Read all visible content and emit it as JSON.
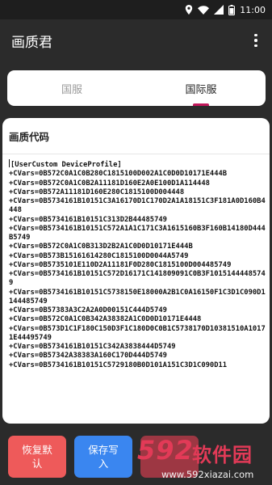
{
  "status_bar": {
    "time": "11:00"
  },
  "app": {
    "title": "画质君"
  },
  "tabs": [
    {
      "label": "国服",
      "active": false
    },
    {
      "label": "国际服",
      "active": true
    }
  ],
  "card": {
    "header": "画质代码",
    "code_lines": [
      "[UserCustom DeviceProfile]",
      "+CVars=0B572C0A1C0B280C1815100D002A1C0D0D10171E444B",
      "+CVars=0B572C0A1C0B2A11181D160E2A0E100D1A114448",
      "+CVars=0B572A11181D160E280C1815100D004448",
      "+CVars=0B5734161B10151C3A16170D1C170D2A1A18151C3F181A0D160B4448",
      "+CVars=0B5734161B10151C313D2B44485749",
      "+CVars=0B5734161B10151C572A1A1C171C3A1615160B3F160B14180D444B5749",
      "+CVars=0B572C0A1C0B313D2B2A1C0D0D10171E444B",
      "+CVars=0B573B15161614280C1815100D0044A5749",
      "+CVars=0B5735101E110D2A11181F0D280C1815100D004485749",
      "+CVars=0B5734161B10151C572D16171C141809091C0B3F10151444485749",
      "+CVars=0B5734161B10151C5738150E18000A2B1C0A16150F1C3D1C090D1144485749",
      "+CVars=0B57383A3C2A2A0D00151C444D5749",
      "+CVars=0B572C0A1C0B342A38382A1C0D0D10171E4448",
      "+CVars=0B573D1C1F180C150D3F1C180D0C0B1C5738170D10381510A10171E44495749",
      "+CVars=0B5734161B10151C342A3838444D5749",
      "+CVars=0B57342A38383A160C170D444D5749",
      "+CVars=0B5734161B10151C5729180B0D101A151C3D1C090D11"
    ]
  },
  "buttons": {
    "restore_label": "恢复默认",
    "save_label": "保存写入",
    "third_label": ""
  },
  "watermark": {
    "brand": "592",
    "cn": "软件园",
    "url": "www.592xiazai.com"
  },
  "colors": {
    "background": "#2b2b2b",
    "tab_indicator": "#c2185b",
    "restore_button": "#ee5a5a",
    "save_button": "#3a86f0",
    "watermark": "#e23a57"
  }
}
